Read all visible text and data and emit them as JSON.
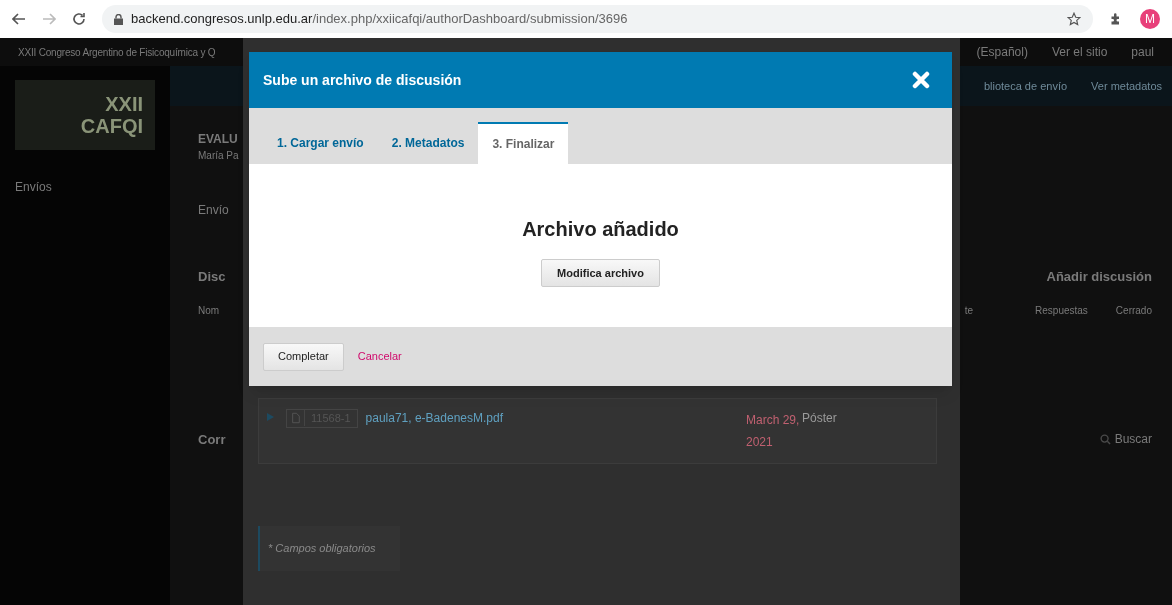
{
  "browser": {
    "url_host": "backend.congresos.unlp.edu.ar",
    "url_path": "/index.php/xxiicafqi/authorDashboard/submission/3696",
    "profile_initial": "M"
  },
  "page": {
    "site_title": "XXII Congreso Argentino de Fisicoquímica y Q",
    "top_links": [
      "(Español)",
      "Ver el sitio",
      "paul"
    ],
    "logo": [
      "XXII",
      "CAFQI"
    ],
    "nav_links": [
      "blioteca de envío",
      "Ver metadatos"
    ],
    "sidebar": {
      "items": [
        "Envíos"
      ]
    },
    "submission": {
      "title": "EVALU",
      "author": "María Pa",
      "tab": "Envío"
    },
    "discussion": {
      "heading": "Disc",
      "add_button": "Añadir discusión",
      "columns": [
        "Nom",
        "te",
        "Respuestas",
        "Cerrado"
      ]
    },
    "correspondence": {
      "heading": "Corr",
      "search_button": "Buscar"
    }
  },
  "file_panel": {
    "files": [
      {
        "expanded": false,
        "id": "11568-1",
        "name": "paula71, e-BadenesM.pdf",
        "date": "March 29, 2021",
        "type": "Póster"
      }
    ],
    "required_note": "* Campos obligatorios"
  },
  "modal": {
    "title": "Sube un archivo de discusión",
    "tabs": [
      {
        "label": "1. Cargar envío",
        "selected": false
      },
      {
        "label": "2. Metadatos",
        "selected": false
      },
      {
        "label": "3. Finalizar",
        "selected": true
      }
    ],
    "heading": "Archivo añadido",
    "edit_button": "Modifica archivo",
    "complete_button": "Completar",
    "cancel_link": "Cancelar"
  }
}
